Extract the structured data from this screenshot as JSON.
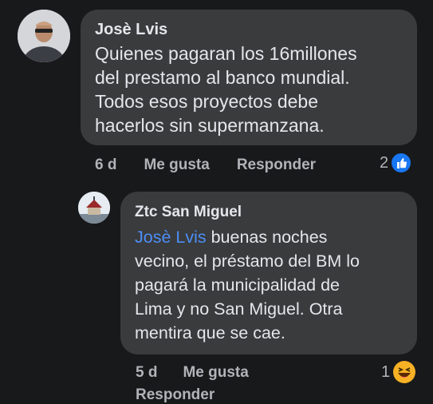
{
  "comment1": {
    "author": "Josè Lvis",
    "lines": [
      "Quienes pagaran los 16millones",
      "del prestamo al banco mundial.",
      "Todos esos proyectos debe",
      "hacerlos sin supermanzana."
    ],
    "time": "6 d",
    "like_label": "Me gusta",
    "reply_label": "Responder",
    "reaction_count": "2",
    "reaction_icon": "like-icon",
    "reaction_color": "#1877f2"
  },
  "comment2": {
    "author": "Ztc San Miguel",
    "mention": "Josè Lvis",
    "lines": [
      " buenas noches",
      "vecino, el préstamo del BM lo",
      "pagará la municipalidad de",
      "Lima y no San Miguel. Otra",
      "mentira que se cae."
    ],
    "time": "5 d",
    "like_label": "Me gusta",
    "reply_label": "Responder",
    "reaction_count": "1",
    "reaction_icon": "haha-icon",
    "reaction_color": "#f7b125"
  }
}
